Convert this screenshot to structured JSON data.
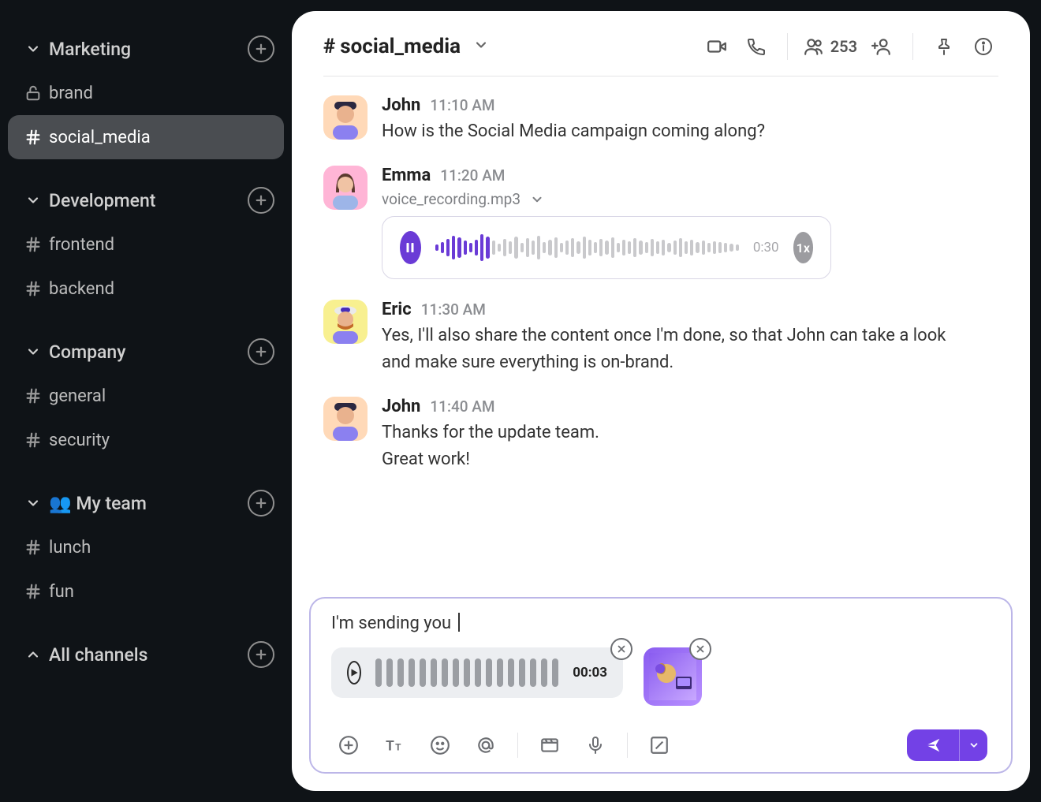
{
  "sidebar": {
    "groups": [
      {
        "label": "Marketing",
        "expanded": true,
        "channels": [
          {
            "label": "brand",
            "icon": "lock",
            "active": false
          },
          {
            "label": "social_media",
            "icon": "hash",
            "active": true
          }
        ]
      },
      {
        "label": "Development",
        "expanded": true,
        "channels": [
          {
            "label": "frontend",
            "icon": "hash",
            "active": false
          },
          {
            "label": "backend",
            "icon": "hash",
            "active": false
          }
        ]
      },
      {
        "label": "Company",
        "expanded": true,
        "channels": [
          {
            "label": "general",
            "icon": "hash",
            "active": false
          },
          {
            "label": "security",
            "icon": "hash",
            "active": false
          }
        ]
      },
      {
        "label": "👥 My team",
        "expanded": true,
        "channels": [
          {
            "label": "lunch",
            "icon": "hash",
            "active": false
          },
          {
            "label": "fun",
            "icon": "hash",
            "active": false
          }
        ]
      }
    ],
    "footer": {
      "label": "All channels",
      "expanded": false
    }
  },
  "header": {
    "hash": "#",
    "title": "social_media",
    "member_count": "253"
  },
  "messages": [
    {
      "author": "John",
      "avatar": "john",
      "time": "11:10 AM",
      "text": "How is the Social Media campaign coming along?"
    },
    {
      "author": "Emma",
      "avatar": "emma",
      "time": "11:20 AM",
      "attachment": {
        "type": "voice",
        "filename": "voice_recording.mp3",
        "duration": "0:30",
        "speed": "1x",
        "playing": true
      }
    },
    {
      "author": "Eric",
      "avatar": "eric",
      "time": "11:30 AM",
      "text": "Yes, I'll also share the content once I'm done, so that John can take a look and make sure everything is on-brand."
    },
    {
      "author": "John",
      "avatar": "john",
      "time": "11:40 AM",
      "text": "Thanks for the update team.\nGreat work!"
    }
  ],
  "composer": {
    "text": "I'm sending you ",
    "attachments": {
      "audio_duration": "00:03"
    }
  }
}
